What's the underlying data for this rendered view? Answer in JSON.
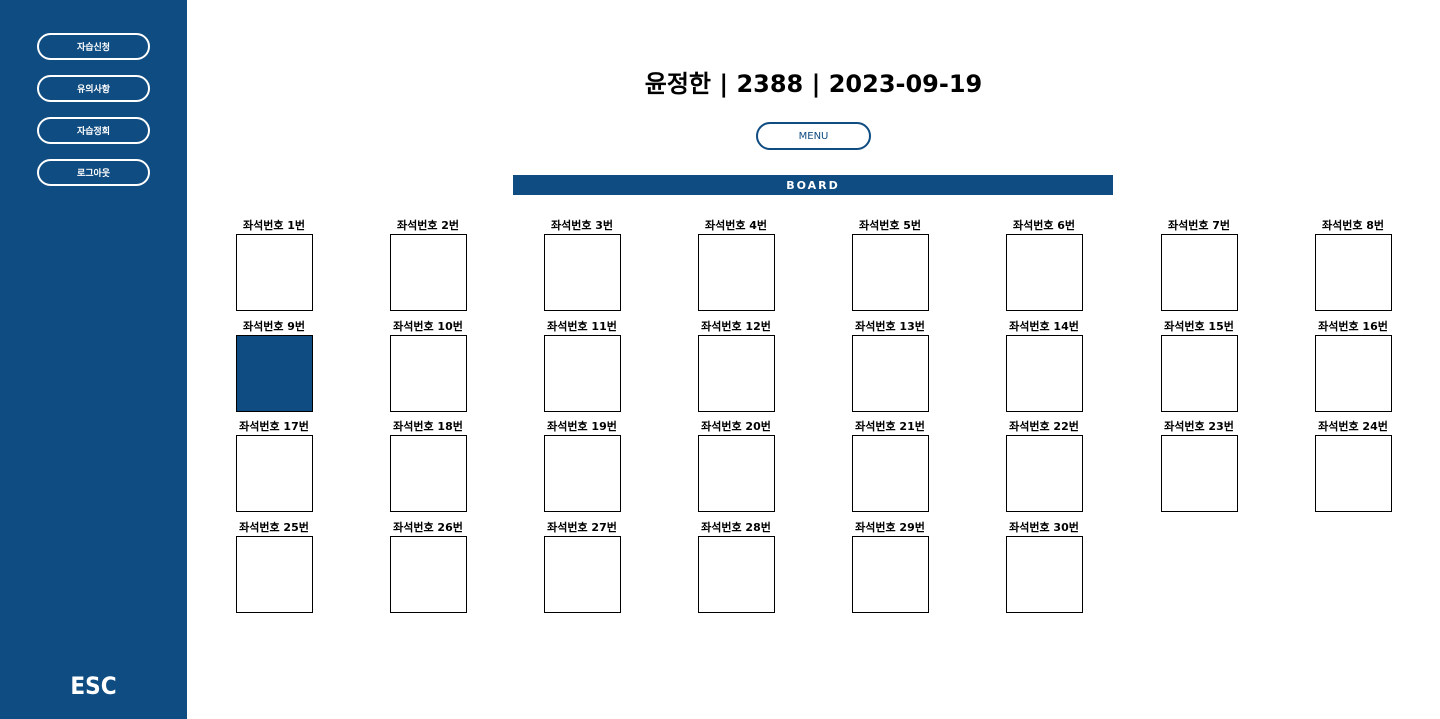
{
  "sidebar": {
    "buttons": [
      "자습신청",
      "유의사항",
      "자습정회",
      "로그아웃"
    ],
    "logo": "ESC"
  },
  "header": {
    "title": "윤정한  |  2388  |  2023-09-19"
  },
  "menu_button": "MENU",
  "board_title": "BOARD",
  "colors": {
    "primary": "#0f4c81",
    "background": "#ffffff"
  },
  "seats": [
    {
      "label": "좌석번호 1번",
      "selected": false
    },
    {
      "label": "좌석번호 2번",
      "selected": false
    },
    {
      "label": "좌석번호 3번",
      "selected": false
    },
    {
      "label": "좌석번호 4번",
      "selected": false
    },
    {
      "label": "좌석번호 5번",
      "selected": false
    },
    {
      "label": "좌석번호 6번",
      "selected": false
    },
    {
      "label": "좌석번호 7번",
      "selected": false
    },
    {
      "label": "좌석번호 8번",
      "selected": false
    },
    {
      "label": "좌석번호 9번",
      "selected": true
    },
    {
      "label": "좌석번호 10번",
      "selected": false
    },
    {
      "label": "좌석번호 11번",
      "selected": false
    },
    {
      "label": "좌석번호 12번",
      "selected": false
    },
    {
      "label": "좌석번호 13번",
      "selected": false
    },
    {
      "label": "좌석번호 14번",
      "selected": false
    },
    {
      "label": "좌석번호 15번",
      "selected": false
    },
    {
      "label": "좌석번호 16번",
      "selected": false
    },
    {
      "label": "좌석번호 17번",
      "selected": false
    },
    {
      "label": "좌석번호 18번",
      "selected": false
    },
    {
      "label": "좌석번호 19번",
      "selected": false
    },
    {
      "label": "좌석번호 20번",
      "selected": false
    },
    {
      "label": "좌석번호 21번",
      "selected": false
    },
    {
      "label": "좌석번호 22번",
      "selected": false
    },
    {
      "label": "좌석번호 23번",
      "selected": false
    },
    {
      "label": "좌석번호 24번",
      "selected": false
    },
    {
      "label": "좌석번호 25번",
      "selected": false
    },
    {
      "label": "좌석번호 26번",
      "selected": false
    },
    {
      "label": "좌석번호 27번",
      "selected": false
    },
    {
      "label": "좌석번호 28번",
      "selected": false
    },
    {
      "label": "좌석번호 29번",
      "selected": false
    },
    {
      "label": "좌석번호 30번",
      "selected": false
    }
  ]
}
